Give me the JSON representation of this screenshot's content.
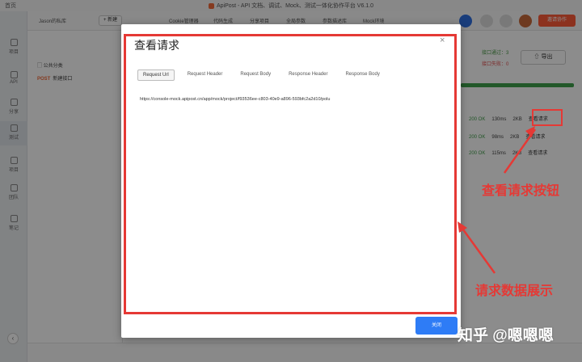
{
  "window": {
    "title": "ApiPost - API 文档、调试、Mock、测试一体化协作平台 V6.1.0",
    "left_text": "首页"
  },
  "sidebar": {
    "items": [
      {
        "label": "项目"
      },
      {
        "label": "API"
      },
      {
        "label": "分享"
      },
      {
        "label": "测试"
      },
      {
        "label": "项目"
      },
      {
        "label": "团队"
      },
      {
        "label": "笔记"
      }
    ]
  },
  "toolbar": {
    "project_name": "Jason的私库",
    "new_button": "+ 新建",
    "cookie_manager": "Cookie管理器",
    "code_gen": "代码生成",
    "share_project": "分享项目",
    "global_params": "全局参数",
    "param_desc": "参数描述库",
    "mock_env": "Mock环境",
    "invite_button": "邀请协作"
  },
  "project_panel": {
    "folder_label": "公共分类",
    "request_method": "POST",
    "request_name": "新建接口"
  },
  "background": {
    "stat_1": "接口通过：3",
    "stat_2": "接口失败：0",
    "export_button": "导出",
    "rows": [
      {
        "status": "200 OK",
        "time": "130ms",
        "size": "2KB",
        "action": "查看请求"
      },
      {
        "status": "200 OK",
        "time": "98ms",
        "size": "2KB",
        "action": "查看请求"
      },
      {
        "status": "200 OK",
        "time": "115ms",
        "size": "2KB",
        "action": "查看请求"
      }
    ]
  },
  "modal": {
    "title": "查看请求",
    "close_icon": "×",
    "tabs": [
      "Request Url",
      "Request Header",
      "Request Body",
      "Response Header",
      "Response Body"
    ],
    "active_tab": "Request Url",
    "url": "https://console-mock.apipost.cn/app/mock/project/f93536ee-c803-40e9-a896-593bfc2a2d10/polu",
    "footer_button": "关闭"
  },
  "annotations": {
    "button_label": "查看请求按钮",
    "data_label": "请求数据展示",
    "color": "#e53935"
  },
  "watermark": "知乎 @嗯嗯嗯"
}
